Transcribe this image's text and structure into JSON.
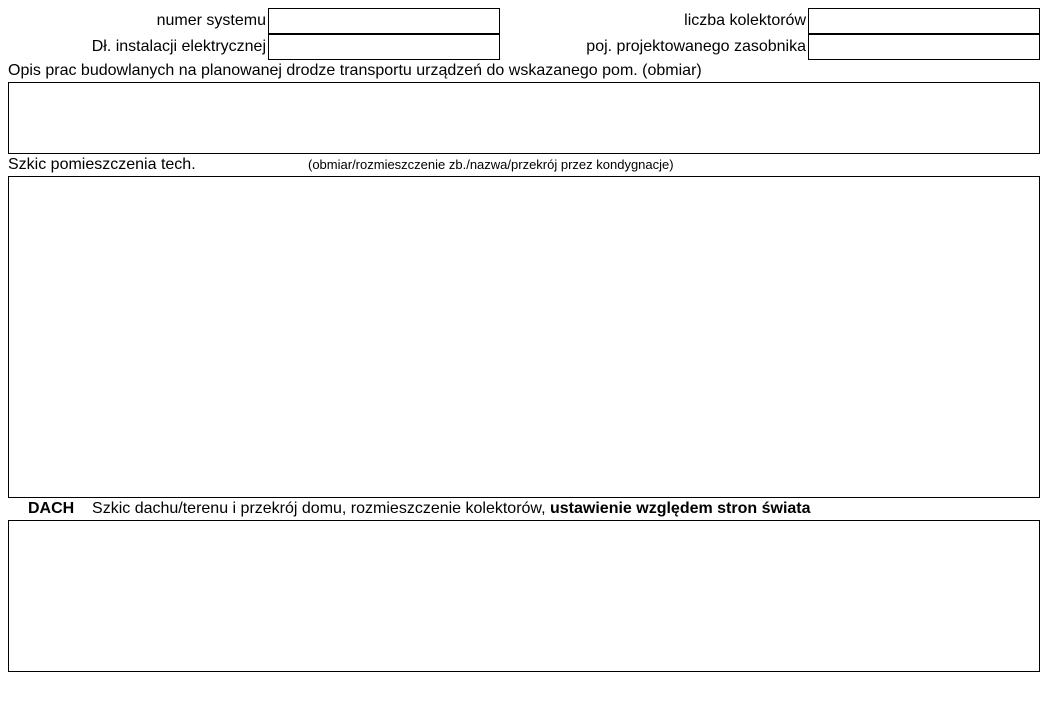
{
  "row1": {
    "label1": "numer systemu",
    "label2": "liczba kolektorów"
  },
  "row2": {
    "label1": "Dł. instalacji elektrycznej",
    "label2": "poj. projektowanego zasobnika"
  },
  "section1": {
    "heading": "Opis prac budowlanych na planowanej drodze transportu urządzeń do wskazanego pom. (obmiar)"
  },
  "section2": {
    "title": "Szkic pomieszczenia tech.",
    "hint": "(obmiar/rozmieszczenie zb./nazwa/przekrój przez kondygnacje)"
  },
  "section3": {
    "dach": "DACH",
    "desc": "Szkic dachu/terenu i przekrój domu, rozmieszczenie kolektorów, ",
    "bold_desc": "ustawienie względem stron świata"
  }
}
